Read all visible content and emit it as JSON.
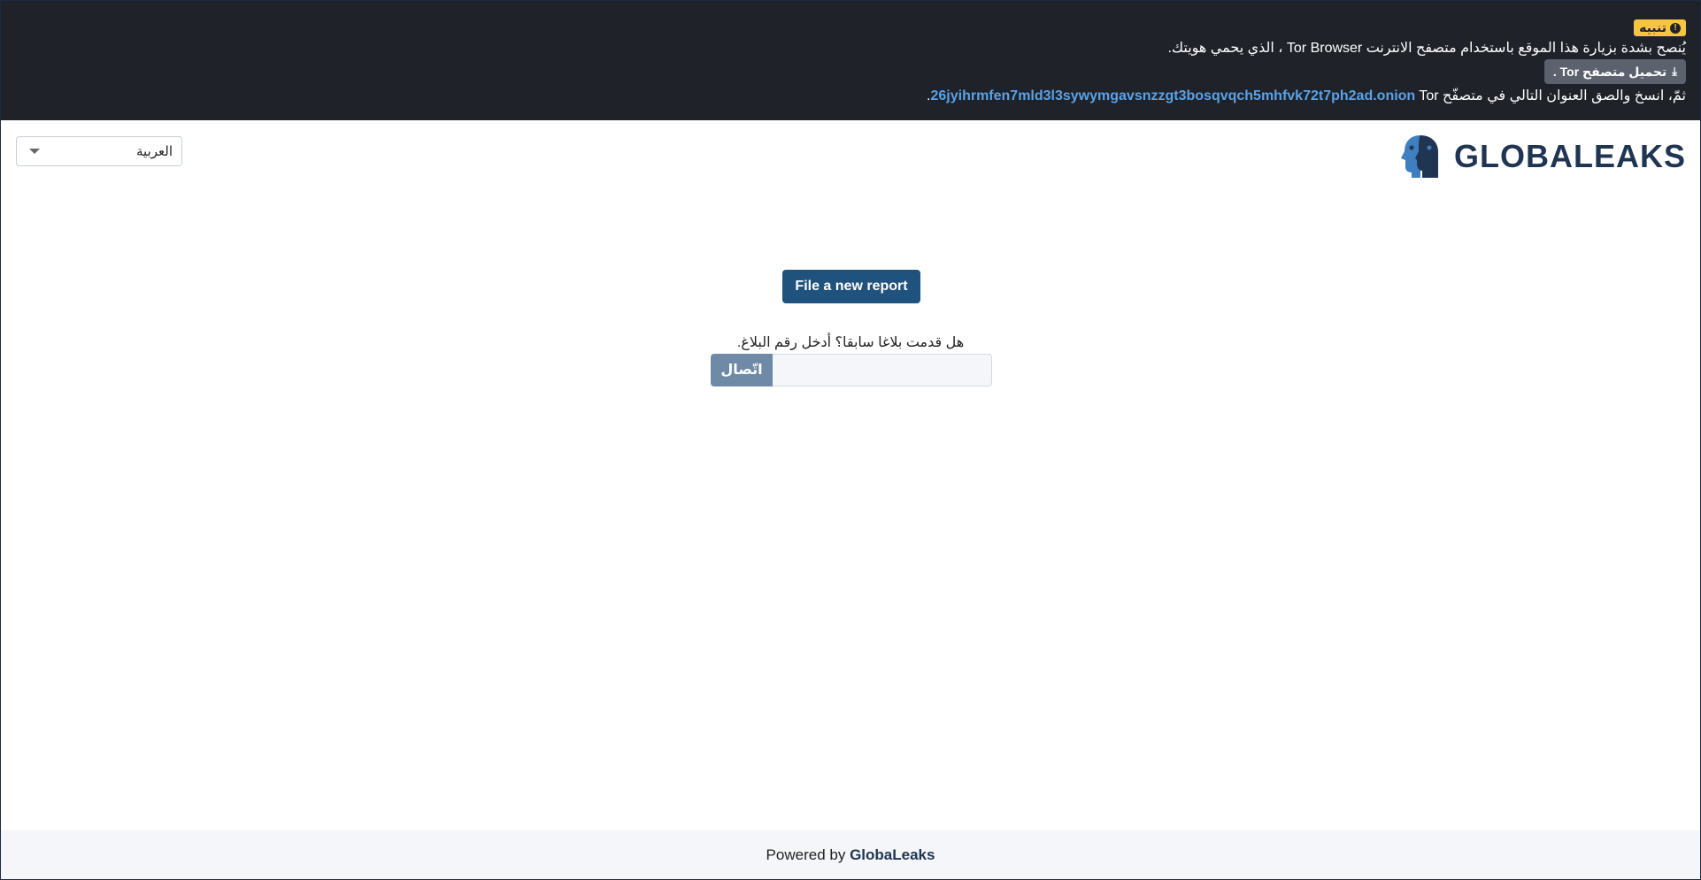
{
  "banner": {
    "badge_label": "تنبيه",
    "badge_icon": "exclamation-circle-icon",
    "line1": "يُنصح بشدة بزيارة هذا الموقع باستخدام متصفح الانترنت Tor Browser ، الذي يحمي هويتك.",
    "download_label": "تحميل متصفح Tor .",
    "download_icon": "download-icon",
    "line3_prefix": "ثمّ، انسخ والصق العنوان التالي في متصفّح",
    "onion_address": "26jyihrmfen7mld3l3sywymgavsnzzgt3bosqvqch5mhfvk72t7ph2ad.onion",
    "line3_suffix": "Tor."
  },
  "header": {
    "logo_text": "GLOBALEAKS",
    "language_selected": "العربية"
  },
  "main": {
    "file_report_label": "File a new report",
    "receipt_prompt": "هل قدمت بلاغا سابقا؟ أدخل رقم البلاغ.",
    "connect_label": "اتّصال",
    "receipt_value": ""
  },
  "footer": {
    "powered_by": "Powered by",
    "brand": "GlobaLeaks"
  },
  "colors": {
    "banner_bg": "#1f2229",
    "badge_bg": "#f5c542",
    "link": "#5aa2e6",
    "primary": "#1f527c",
    "connect": "#6e8aa6",
    "brand": "#1f3552"
  }
}
